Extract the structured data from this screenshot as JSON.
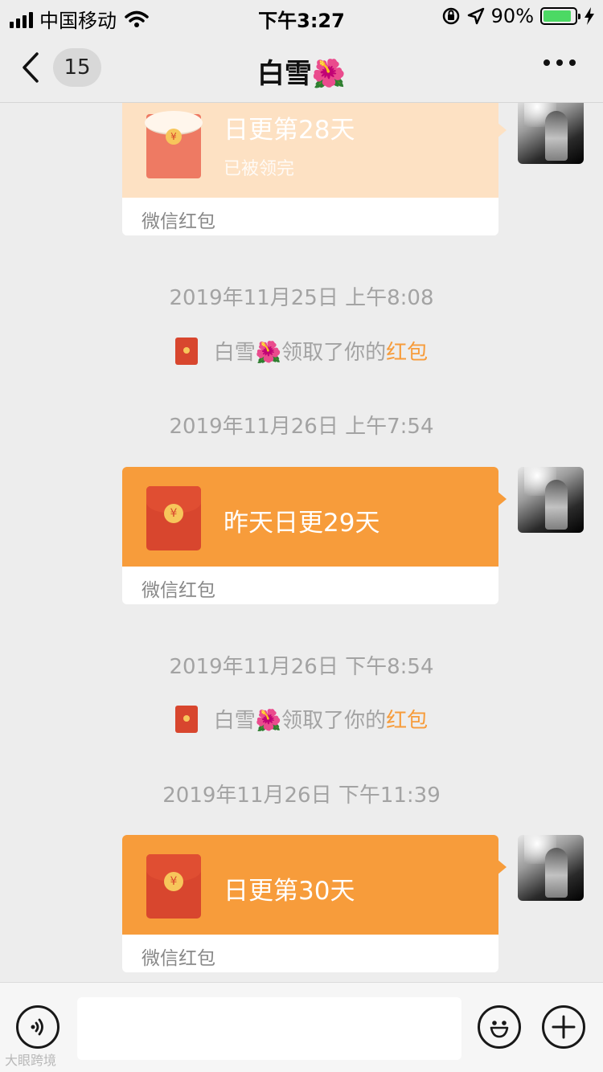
{
  "status_bar": {
    "carrier": "中国移动",
    "time": "下午3:27",
    "battery_percent": "90%",
    "battery_level": 0.9
  },
  "nav": {
    "unread_count": "15",
    "title": "白雪🌺"
  },
  "messages": [
    {
      "type": "red_packet",
      "state": "opened",
      "title": "日更第28天",
      "status": "已被领完",
      "footer": "微信红包"
    },
    {
      "type": "timestamp",
      "text": "2019年11月25日 上午8:08"
    },
    {
      "type": "system",
      "prefix": "白雪🌺领取了你的",
      "link": "红包"
    },
    {
      "type": "timestamp",
      "text": "2019年11月26日 上午7:54"
    },
    {
      "type": "red_packet",
      "state": "unopened",
      "title": "昨天日更29天",
      "footer": "微信红包"
    },
    {
      "type": "timestamp",
      "text": "2019年11月26日 下午8:54"
    },
    {
      "type": "system",
      "prefix": "白雪🌺领取了你的",
      "link": "红包"
    },
    {
      "type": "timestamp",
      "text": "2019年11月26日 下午11:39"
    },
    {
      "type": "red_packet",
      "state": "unopened",
      "title": "日更第30天",
      "footer": "微信红包"
    }
  ],
  "input_bar": {
    "voice_icon": "voice-icon",
    "emoji_icon": "emoji-icon",
    "plus_icon": "plus-icon"
  },
  "watermark": "大眼跨境",
  "colors": {
    "red_packet_orange": "#f79c3b",
    "red_packet_opened": "#fde1c3",
    "link_orange": "#f79c3b",
    "battery_green": "#4cd964"
  }
}
